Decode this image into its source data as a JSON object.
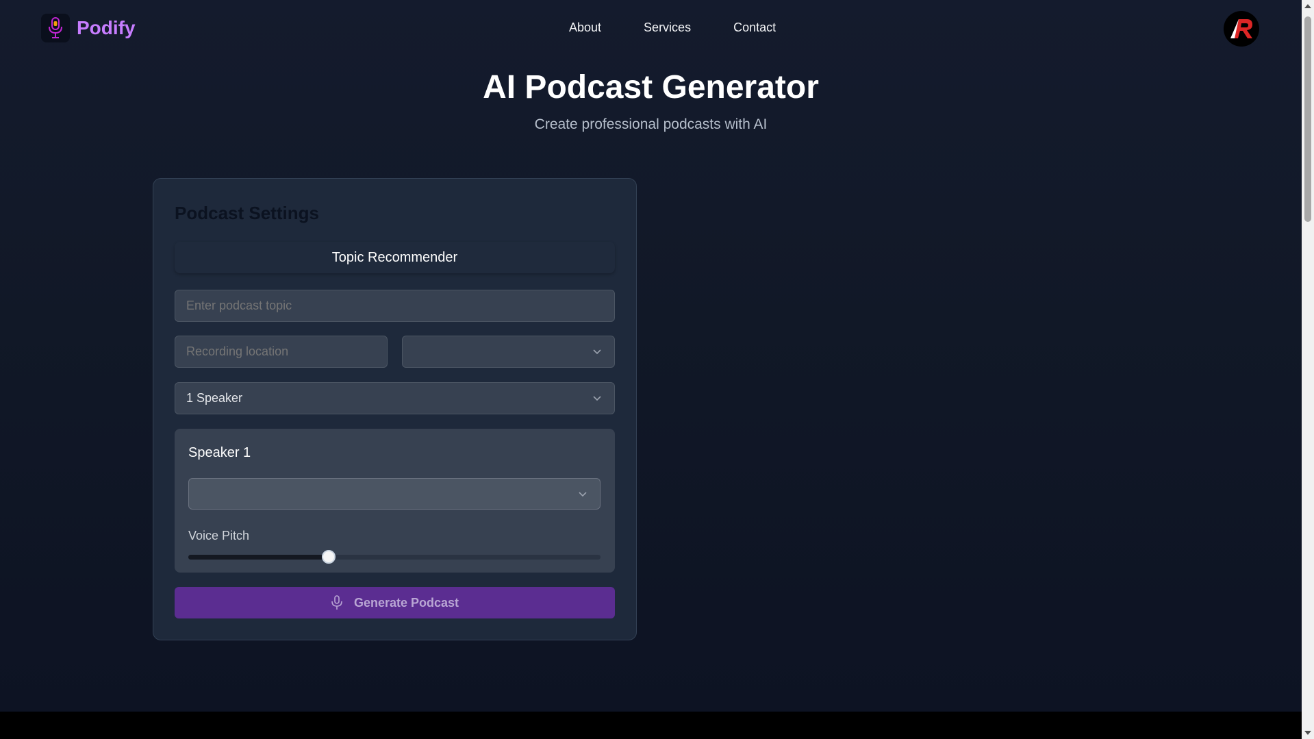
{
  "header": {
    "brand": "Podify",
    "brand_icon": "microphone-icon",
    "nav": [
      {
        "label": "About"
      },
      {
        "label": "Services"
      },
      {
        "label": "Contact"
      }
    ],
    "avatar_icon": "user-avatar-icon"
  },
  "hero": {
    "title": "AI Podcast Generator",
    "subtitle": "Create professional podcasts with AI"
  },
  "settings": {
    "title": "Podcast Settings",
    "topic_recommender_label": "Topic Recommender",
    "topic_placeholder": "Enter podcast topic",
    "location_placeholder": "Recording location",
    "location_select_value": "",
    "speaker_count_value": "1 Speaker",
    "speaker": {
      "title": "Speaker 1",
      "voice_value": "",
      "pitch_label": "Voice Pitch",
      "pitch_fraction": 0.34
    },
    "generate_label": "Generate Podcast",
    "generate_icon": "microphone-icon"
  },
  "colors": {
    "brand": "#c77dff",
    "primary_button": "#5b2d91",
    "background": "#111827",
    "card": "#1e293b"
  }
}
